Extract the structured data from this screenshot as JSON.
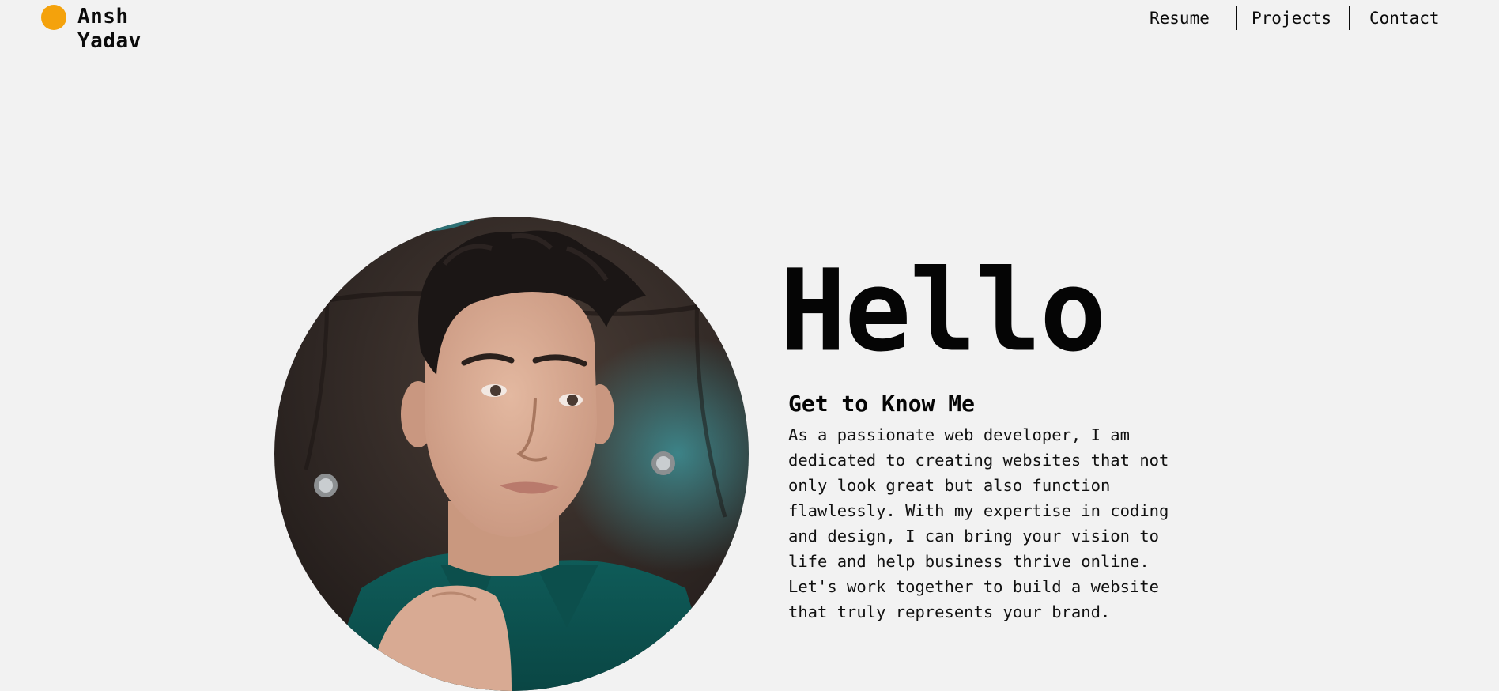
{
  "brand": {
    "name_line1": "Ansh",
    "name_line2": "Yadav",
    "dot_color": "#f4a20c"
  },
  "nav": {
    "resume": "Resume",
    "projects": "Projects",
    "contact": "Contact"
  },
  "hero": {
    "greeting": "Hello",
    "about_title": "Get to Know Me",
    "about_text": "As a passionate web developer, I am dedicated to creating websites that not only look great but also function flawlessly. With my expertise in coding and design, I can bring your vision to life and help business thrive online. Let's work together to build a website that truly represents your brand."
  },
  "colors": {
    "background": "#f2f2f2",
    "text": "#0b0b0b",
    "accent": "#f4a20c"
  }
}
